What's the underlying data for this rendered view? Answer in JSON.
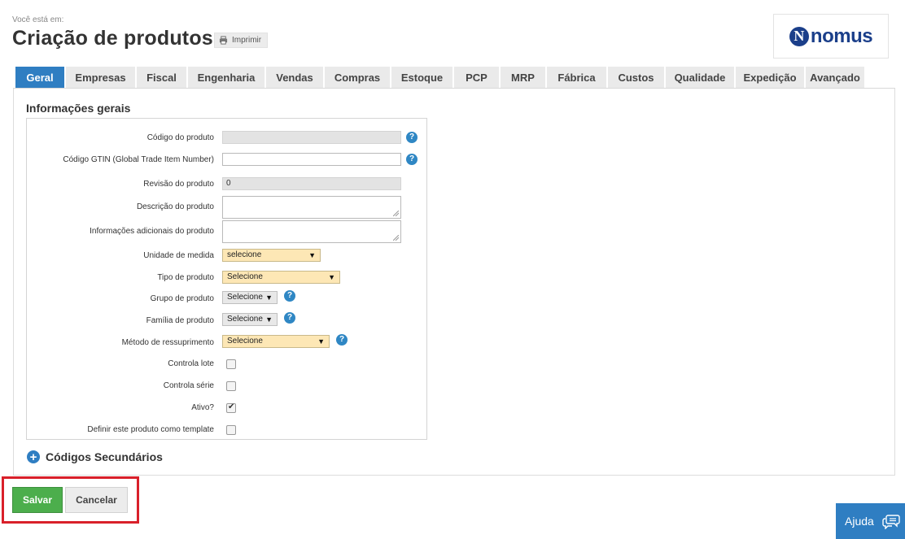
{
  "header": {
    "breadcrumb_label": "Você está em:",
    "title": "Criação de produtos",
    "print_label": "Imprimir",
    "logo_text": "nomus",
    "brand_color": "#1b3f8a"
  },
  "tabs": [
    {
      "label": "Geral",
      "active": true
    },
    {
      "label": "Empresas"
    },
    {
      "label": "Fiscal"
    },
    {
      "label": "Engenharia"
    },
    {
      "label": "Vendas"
    },
    {
      "label": "Compras"
    },
    {
      "label": "Estoque"
    },
    {
      "label": "PCP"
    },
    {
      "label": "MRP"
    },
    {
      "label": "Fábrica"
    },
    {
      "label": "Custos"
    },
    {
      "label": "Qualidade"
    },
    {
      "label": "Expedição"
    },
    {
      "label": "Avançado"
    }
  ],
  "form": {
    "section_title": "Informações gerais",
    "codigo_produto": {
      "label": "Código do produto",
      "value": ""
    },
    "codigo_gtin": {
      "label": "Código GTIN (Global Trade Item Number)",
      "value": ""
    },
    "revisao": {
      "label": "Revisão do produto",
      "value": "0"
    },
    "descricao": {
      "label": "Descrição do produto",
      "value": ""
    },
    "info_adicionais": {
      "label": "Informações adicionais do produto",
      "value": ""
    },
    "unidade_medida": {
      "label": "Unidade de medida",
      "value": "selecione"
    },
    "tipo_produto": {
      "label": "Tipo de produto",
      "value": "Selecione"
    },
    "grupo_produto": {
      "label": "Grupo de produto",
      "value": "Selecione"
    },
    "familia_produto": {
      "label": "Família de produto",
      "value": "Selecione"
    },
    "metodo_ressuprimento": {
      "label": "Método de ressuprimento",
      "value": "Selecione"
    },
    "controla_lote": {
      "label": "Controla lote",
      "checked": false
    },
    "controla_serie": {
      "label": "Controla série",
      "checked": false
    },
    "ativo": {
      "label": "Ativo?",
      "checked": true
    },
    "template": {
      "label": "Definir este produto como template",
      "checked": false
    },
    "help_glyph": "?",
    "arrow_glyph": "▼"
  },
  "secondary_codes": {
    "label": "Códigos Secundários",
    "icon": "+"
  },
  "actions": {
    "save_label": "Salvar",
    "cancel_label": "Cancelar",
    "save_color": "#4cae4c",
    "highlight_color": "#d9202a"
  },
  "help_fab": {
    "label": "Ajuda",
    "icon": "chat-bubble-icon"
  },
  "colors": {
    "tab_active": "#2f7ec2",
    "select_required": "#fde7b5"
  }
}
